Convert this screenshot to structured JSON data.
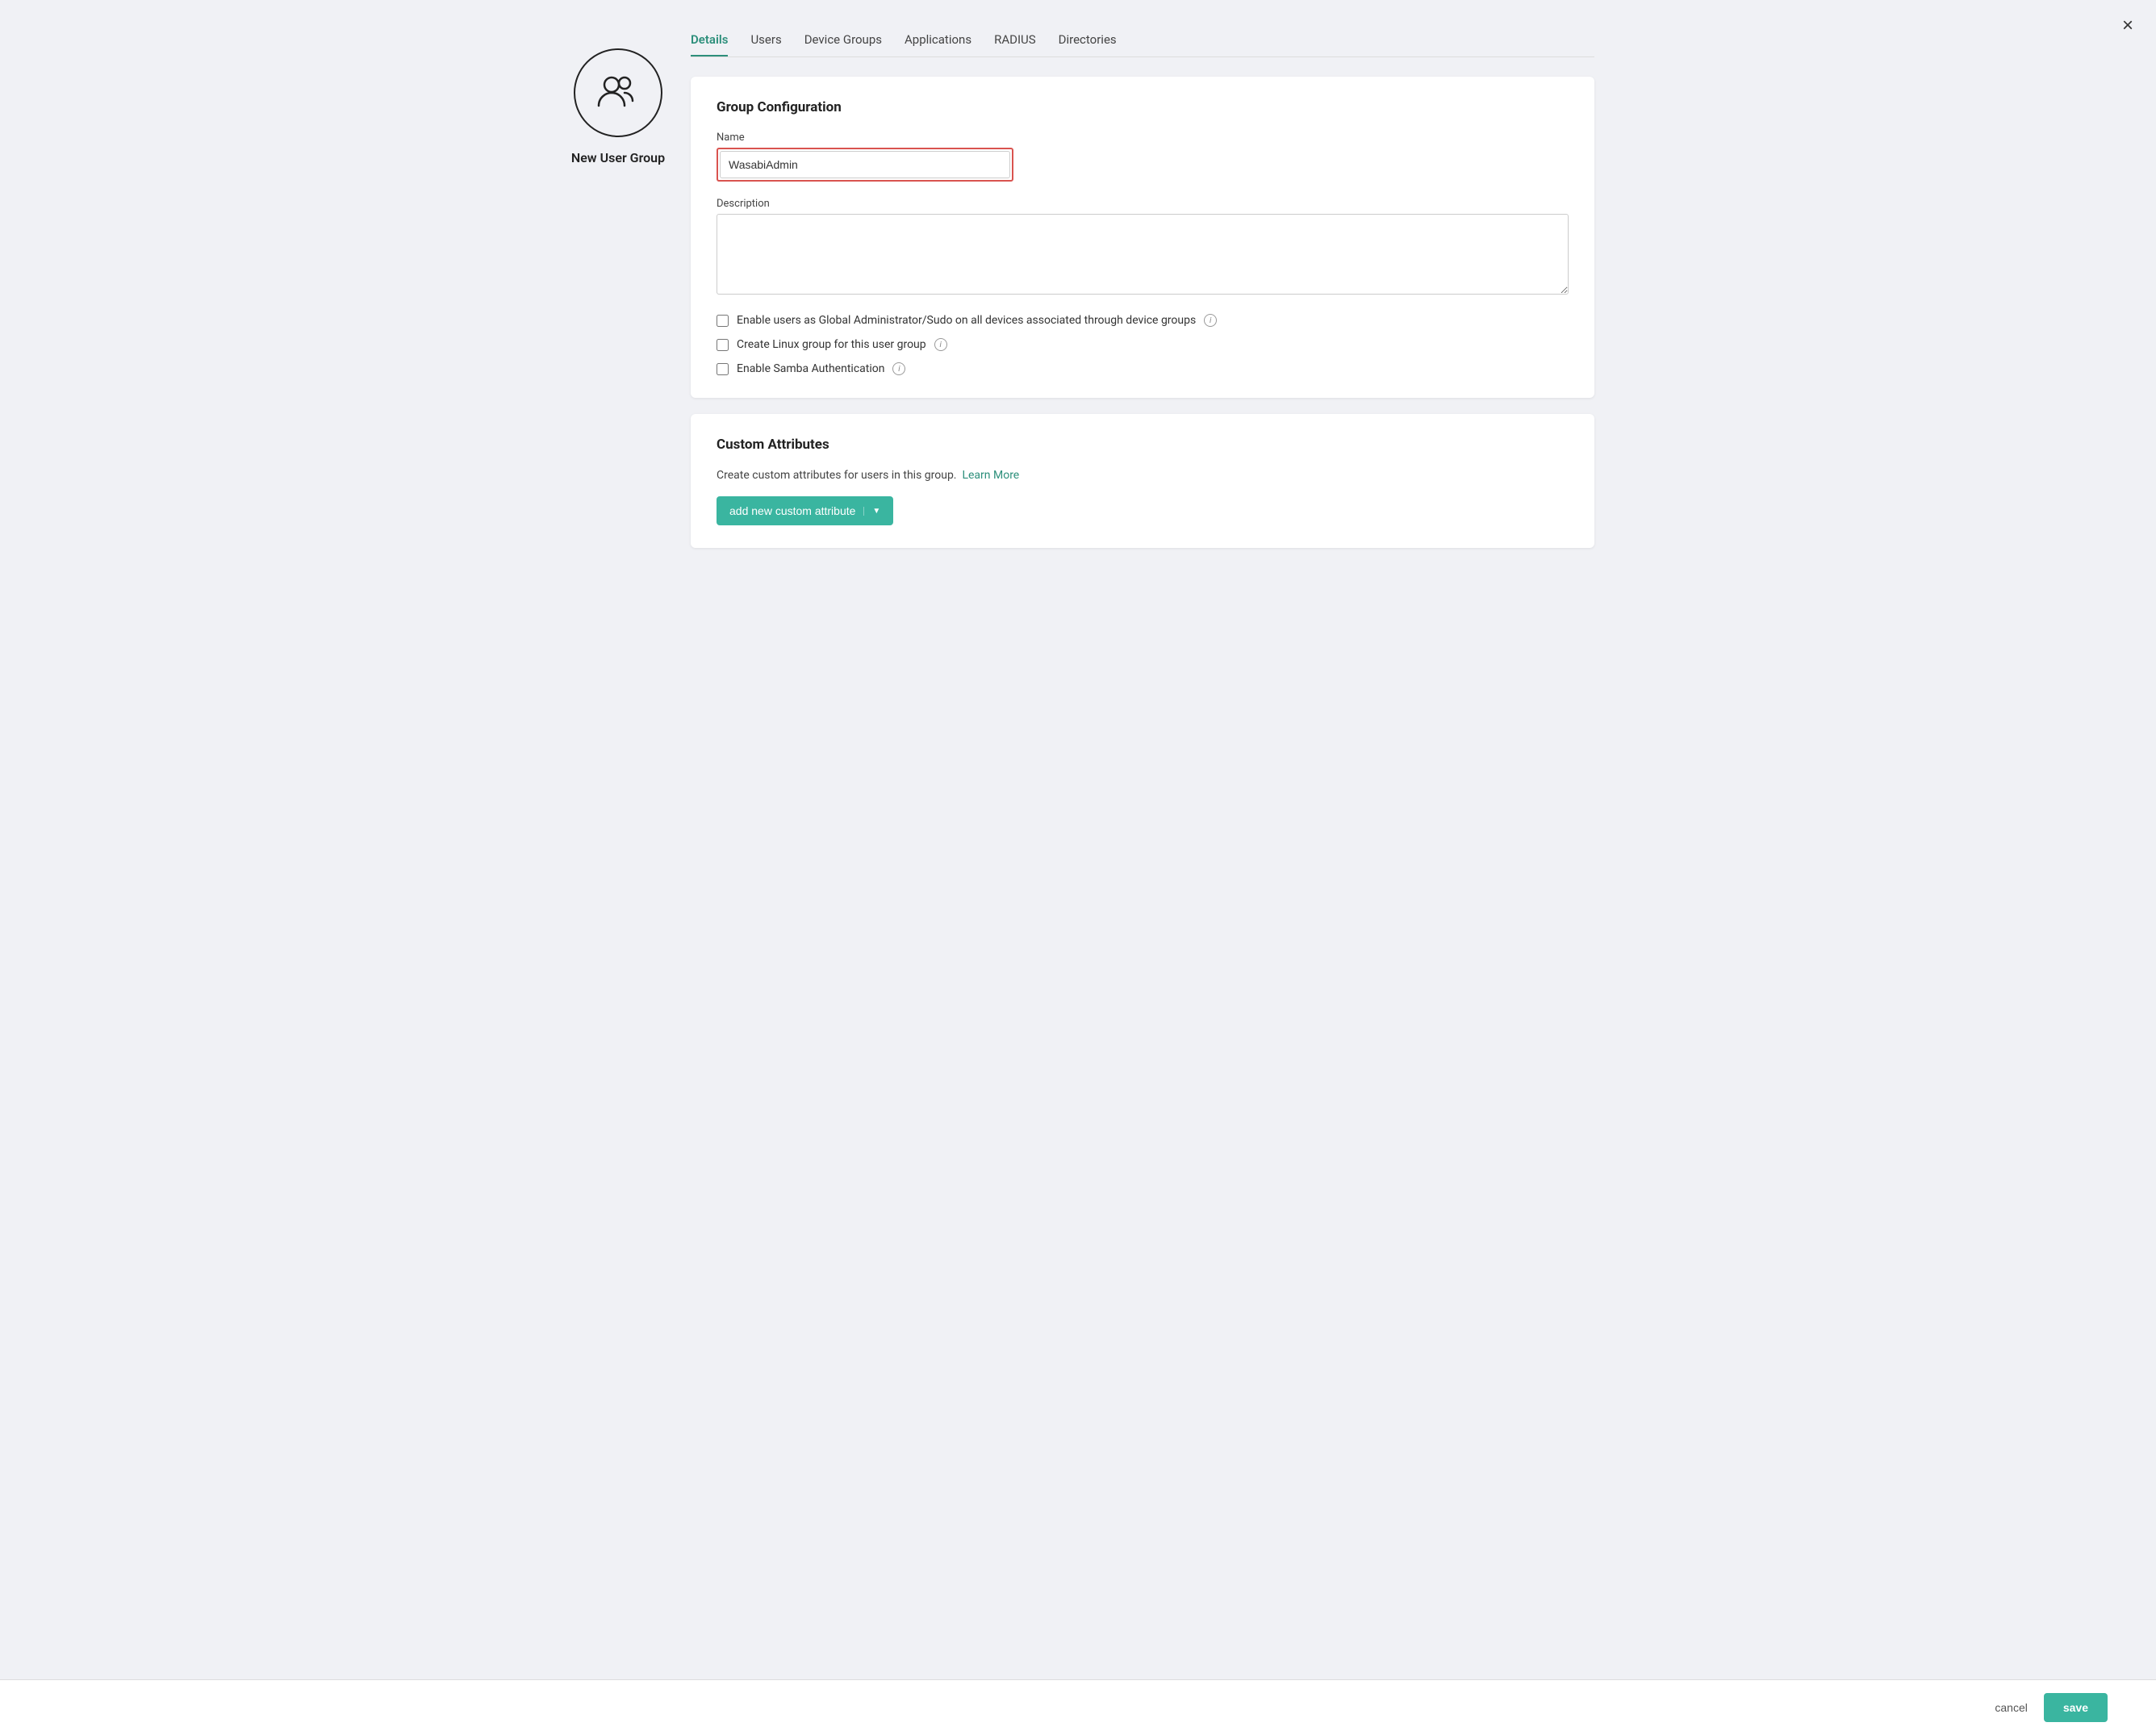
{
  "close": {
    "label": "×"
  },
  "sidebar": {
    "group_label": "New User Group"
  },
  "tabs": [
    {
      "id": "details",
      "label": "Details",
      "active": true
    },
    {
      "id": "users",
      "label": "Users",
      "active": false
    },
    {
      "id": "device-groups",
      "label": "Device Groups",
      "active": false
    },
    {
      "id": "applications",
      "label": "Applications",
      "active": false
    },
    {
      "id": "radius",
      "label": "RADIUS",
      "active": false
    },
    {
      "id": "directories",
      "label": "Directories",
      "active": false
    }
  ],
  "group_configuration": {
    "title": "Group Configuration",
    "name_label": "Name",
    "name_value": "WasabiAdmin",
    "description_label": "Description",
    "description_placeholder": "",
    "checkbox_1": "Enable users as Global Administrator/Sudo on all devices associated through device groups",
    "checkbox_2": "Create Linux group for this user group",
    "checkbox_3": "Enable Samba Authentication"
  },
  "custom_attributes": {
    "title": "Custom Attributes",
    "description": "Create custom attributes for users in this group.",
    "learn_more_label": "Learn More",
    "add_button_label": "add new custom attribute"
  },
  "footer": {
    "cancel_label": "cancel",
    "save_label": "save"
  }
}
